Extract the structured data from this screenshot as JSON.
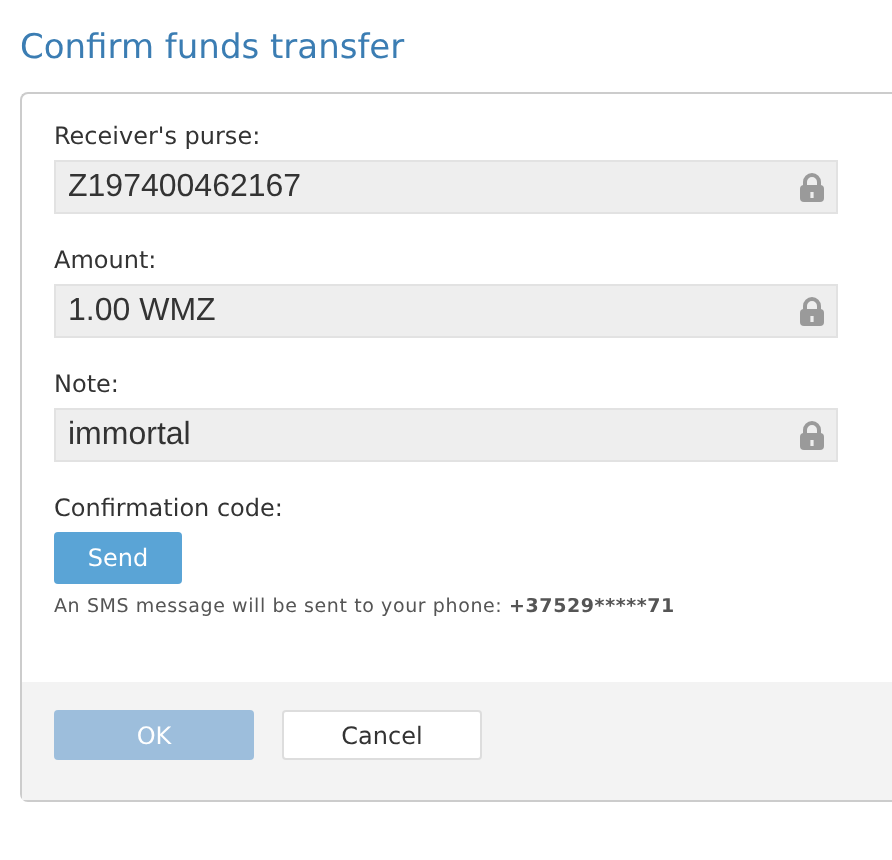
{
  "title": "Confirm funds transfer",
  "fields": [
    {
      "label": "Receiver's purse:",
      "value": "Z197400462167",
      "locked": true
    },
    {
      "label": "Amount:",
      "value": "1.00 WMZ",
      "locked": true
    },
    {
      "label": "Note:",
      "value": "immortal",
      "locked": true
    }
  ],
  "confirmation": {
    "label": "Confirmation code:",
    "send_button": "Send",
    "sms_note": "An SMS message will be sent to your phone:",
    "phone": "+37529*****71"
  },
  "buttons": [
    {
      "label": "OK",
      "kind": "primary",
      "disabled": true
    },
    {
      "label": "Cancel",
      "kind": "secondary",
      "disabled": false
    }
  ]
}
